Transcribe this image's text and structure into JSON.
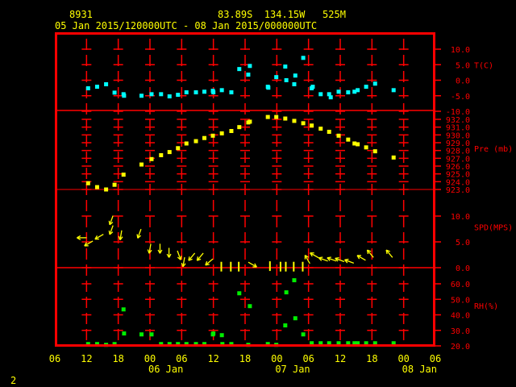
{
  "header": {
    "station_id": "8931",
    "location": "83.89S  134.15W   525M",
    "time_range": "05 Jan 2015/120000UTC - 08 Jan 2015/000000UTC"
  },
  "footer": {
    "page_number": "2"
  },
  "colors": {
    "axis": "#ff0000",
    "text": "#ffff00",
    "temperature": "#00ffff",
    "pressure": "#ffff00",
    "wind": "#ffff00",
    "rh": "#00ee00"
  },
  "chart_data": {
    "type": "scatter",
    "x_units": "hours since 05 Jan 2015 06UTC",
    "xlim": [
      0,
      72
    ],
    "x_ticks": [
      {
        "h": 0,
        "label": "06"
      },
      {
        "h": 6,
        "label": "12"
      },
      {
        "h": 12,
        "label": "18"
      },
      {
        "h": 18,
        "label": "00"
      },
      {
        "h": 24,
        "label": "06"
      },
      {
        "h": 30,
        "label": "12"
      },
      {
        "h": 36,
        "label": "18"
      },
      {
        "h": 42,
        "label": "00"
      },
      {
        "h": 48,
        "label": "06"
      },
      {
        "h": 54,
        "label": "12"
      },
      {
        "h": 60,
        "label": "18"
      },
      {
        "h": 66,
        "label": "00"
      },
      {
        "h": 72,
        "label": "06"
      }
    ],
    "date_labels": [
      {
        "h": 21,
        "label": "06 Jan"
      },
      {
        "h": 45,
        "label": "07 Jan"
      },
      {
        "h": 69,
        "label": "08 Jan"
      }
    ],
    "panels": [
      {
        "name": "temperature",
        "label": "T(C)",
        "ylim": [
          -10,
          12.5
        ],
        "ticks": [
          {
            "v": 10,
            "label": "10.0"
          },
          {
            "v": 5,
            "label": "5.0"
          },
          {
            "v": 0,
            "label": "0.0"
          },
          {
            "v": -5,
            "label": "-5.0"
          },
          {
            "v": -10,
            "label": "-10.0"
          }
        ],
        "points": [
          [
            6.3,
            -2.6
          ],
          [
            8.0,
            -2.1
          ],
          [
            9.7,
            -1.3
          ],
          [
            11.3,
            -4.0
          ],
          [
            13.0,
            -4.5
          ],
          [
            13.1,
            -5.0
          ],
          [
            16.4,
            -5.0
          ],
          [
            18.3,
            -4.5
          ],
          [
            20.1,
            -4.5
          ],
          [
            21.7,
            -5.2
          ],
          [
            23.3,
            -4.7
          ],
          [
            24.9,
            -3.9
          ],
          [
            26.7,
            -3.9
          ],
          [
            28.3,
            -3.7
          ],
          [
            29.9,
            -3.4
          ],
          [
            30.0,
            -3.9
          ],
          [
            31.6,
            -3.2
          ],
          [
            33.4,
            -3.9
          ],
          [
            34.9,
            3.6
          ],
          [
            36.6,
            1.8
          ],
          [
            36.9,
            4.6
          ],
          [
            40.3,
            -2.1
          ],
          [
            40.4,
            -2.4
          ],
          [
            41.9,
            1.0
          ],
          [
            43.6,
            4.4
          ],
          [
            43.8,
            0.0
          ],
          [
            45.3,
            -1.3
          ],
          [
            45.5,
            1.5
          ],
          [
            47.0,
            7.2
          ],
          [
            48.6,
            -2.6
          ],
          [
            48.8,
            -2.1
          ],
          [
            50.3,
            -4.5
          ],
          [
            51.9,
            -4.5
          ],
          [
            52.2,
            -5.5
          ],
          [
            53.7,
            -3.7
          ],
          [
            55.5,
            -3.9
          ],
          [
            56.7,
            -3.7
          ],
          [
            57.3,
            -3.2
          ],
          [
            58.9,
            -2.1
          ],
          [
            60.6,
            -1.1
          ],
          [
            64.1,
            -3.2
          ]
        ]
      },
      {
        "name": "pressure",
        "label": "Pre (mb)",
        "ylim": [
          923,
          933
        ],
        "ticks": [
          {
            "v": 932,
            "label": "932.0"
          },
          {
            "v": 931,
            "label": "931.0"
          },
          {
            "v": 930,
            "label": "930.0"
          },
          {
            "v": 929,
            "label": "929.0"
          },
          {
            "v": 928,
            "label": "928.0"
          },
          {
            "v": 927,
            "label": "927.0"
          },
          {
            "v": 926,
            "label": "926.0"
          },
          {
            "v": 925,
            "label": "925.0"
          },
          {
            "v": 924,
            "label": "924.0"
          },
          {
            "v": 923,
            "label": "923.0"
          }
        ],
        "points": [
          [
            6.3,
            923.8
          ],
          [
            8.0,
            923.3
          ],
          [
            9.7,
            923.0
          ],
          [
            11.3,
            923.6
          ],
          [
            13.0,
            924.9
          ],
          [
            16.4,
            926.2
          ],
          [
            18.3,
            926.9
          ],
          [
            20.1,
            927.4
          ],
          [
            21.7,
            927.8
          ],
          [
            23.3,
            928.3
          ],
          [
            24.9,
            928.9
          ],
          [
            26.7,
            929.2
          ],
          [
            28.3,
            929.6
          ],
          [
            29.9,
            929.9
          ],
          [
            31.6,
            930.2
          ],
          [
            33.4,
            930.5
          ],
          [
            34.9,
            931.0
          ],
          [
            36.6,
            931.6
          ],
          [
            36.9,
            931.7
          ],
          [
            40.3,
            932.3
          ],
          [
            41.9,
            932.3
          ],
          [
            43.6,
            932.1
          ],
          [
            45.3,
            931.8
          ],
          [
            47.0,
            931.5
          ],
          [
            48.6,
            931.2
          ],
          [
            50.3,
            930.8
          ],
          [
            51.9,
            930.4
          ],
          [
            53.7,
            929.9
          ],
          [
            55.5,
            929.4
          ],
          [
            56.7,
            928.9
          ],
          [
            57.3,
            928.8
          ],
          [
            58.9,
            928.4
          ],
          [
            60.6,
            927.9
          ],
          [
            64.1,
            927.1
          ]
        ]
      },
      {
        "name": "wind",
        "label": "SPD(MPS)",
        "ylim": [
          0,
          15.2
        ],
        "ticks": [
          {
            "v": 10,
            "label": "10.0"
          },
          {
            "v": 5,
            "label": "5.0"
          },
          {
            "v": 0,
            "label": "0.0"
          }
        ],
        "points_heading": [
          [
            5.1,
            5.8,
            270
          ],
          [
            6.4,
            4.7,
            240
          ],
          [
            8.4,
            6.0,
            240
          ],
          [
            10.7,
            9.2,
            200
          ],
          [
            10.7,
            7.3,
            200
          ],
          [
            12.5,
            6.3,
            190
          ],
          [
            16.0,
            6.6,
            200
          ],
          [
            18.0,
            3.7,
            190
          ],
          [
            19.9,
            3.7,
            180
          ],
          [
            21.6,
            2.9,
            180
          ],
          [
            23.5,
            2.4,
            160
          ],
          [
            24.4,
            1.1,
            190
          ],
          [
            25.9,
            2.1,
            220
          ],
          [
            27.5,
            2.1,
            220
          ],
          [
            29.2,
            1.1,
            230
          ],
          [
            31.5,
            0.2,
            180
          ],
          [
            33.3,
            0.2,
            180
          ],
          [
            34.8,
            0.2,
            180
          ],
          [
            37.4,
            0.6,
            120
          ],
          [
            40.7,
            0.3,
            160
          ],
          [
            42.7,
            0.2,
            110
          ],
          [
            43.7,
            0.2,
            180
          ],
          [
            45.2,
            0.2,
            180
          ],
          [
            46.9,
            0.2,
            180
          ],
          [
            47.8,
            1.6,
            330
          ],
          [
            49.1,
            2.4,
            300
          ],
          [
            50.8,
            1.6,
            290
          ],
          [
            52.4,
            1.6,
            290
          ],
          [
            53.9,
            1.5,
            290
          ],
          [
            55.7,
            1.2,
            290
          ],
          [
            58.0,
            1.9,
            300
          ],
          [
            59.7,
            2.7,
            320
          ],
          [
            63.3,
            2.7,
            320
          ]
        ]
      },
      {
        "name": "rh",
        "label": "RH(%)",
        "ylim": [
          20,
          70
        ],
        "ticks": [
          {
            "v": 60,
            "label": "60.0"
          },
          {
            "v": 50,
            "label": "50.0"
          },
          {
            "v": 40,
            "label": "40.0"
          },
          {
            "v": 30,
            "label": "30.0"
          },
          {
            "v": 20,
            "label": "20.0"
          }
        ],
        "points": [
          [
            6.3,
            21.2
          ],
          [
            8.0,
            21.2
          ],
          [
            9.7,
            20.7
          ],
          [
            11.3,
            21.2
          ],
          [
            13.0,
            43.5
          ],
          [
            13.1,
            28.0
          ],
          [
            16.4,
            27.4
          ],
          [
            18.3,
            27.4
          ],
          [
            20.1,
            21.2
          ],
          [
            21.7,
            21.2
          ],
          [
            23.3,
            21.2
          ],
          [
            24.9,
            21.2
          ],
          [
            26.7,
            21.2
          ],
          [
            28.3,
            21.2
          ],
          [
            29.9,
            27.4
          ],
          [
            30.0,
            28.0
          ],
          [
            31.6,
            26.9
          ],
          [
            31.7,
            21.2
          ],
          [
            33.4,
            21.2
          ],
          [
            34.9,
            53.9
          ],
          [
            36.6,
            20.7
          ],
          [
            36.9,
            45.6
          ],
          [
            40.3,
            21.2
          ],
          [
            41.9,
            20.7
          ],
          [
            43.6,
            33.2
          ],
          [
            43.8,
            54.5
          ],
          [
            45.3,
            62.3
          ],
          [
            45.5,
            37.8
          ],
          [
            47.0,
            27.4
          ],
          [
            48.6,
            21.7
          ],
          [
            50.3,
            21.7
          ],
          [
            51.9,
            21.7
          ],
          [
            53.7,
            21.7
          ],
          [
            55.5,
            21.7
          ],
          [
            56.7,
            21.7
          ],
          [
            57.3,
            21.7
          ],
          [
            58.9,
            21.7
          ],
          [
            60.6,
            21.7
          ],
          [
            64.1,
            21.7
          ]
        ]
      }
    ]
  }
}
